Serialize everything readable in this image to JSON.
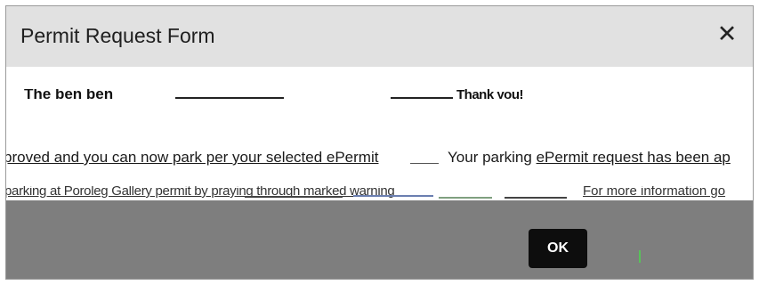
{
  "dialog": {
    "title": "Permit Request Form",
    "close_glyph": "✕",
    "close_icon": "close-icon"
  },
  "body": {
    "heading_fragment": "The ben  ben",
    "thank_you": "Thank you!",
    "message_left": "proved and you can now park per your selected ePermit",
    "message_right_lead": "Your parking ",
    "message_right_link": "ePermit request has been ap",
    "glitch_left": "parking at Poroleg Gallery permit by praying through marked warning",
    "glitch_right": "For more information go"
  },
  "footer": {
    "ok_label": "OK",
    "background": "#7e7e7e"
  },
  "colors": {
    "header_bg": "#e1e1e1",
    "button_bg": "#0d0d0d",
    "accent_green": "#58c25a"
  }
}
